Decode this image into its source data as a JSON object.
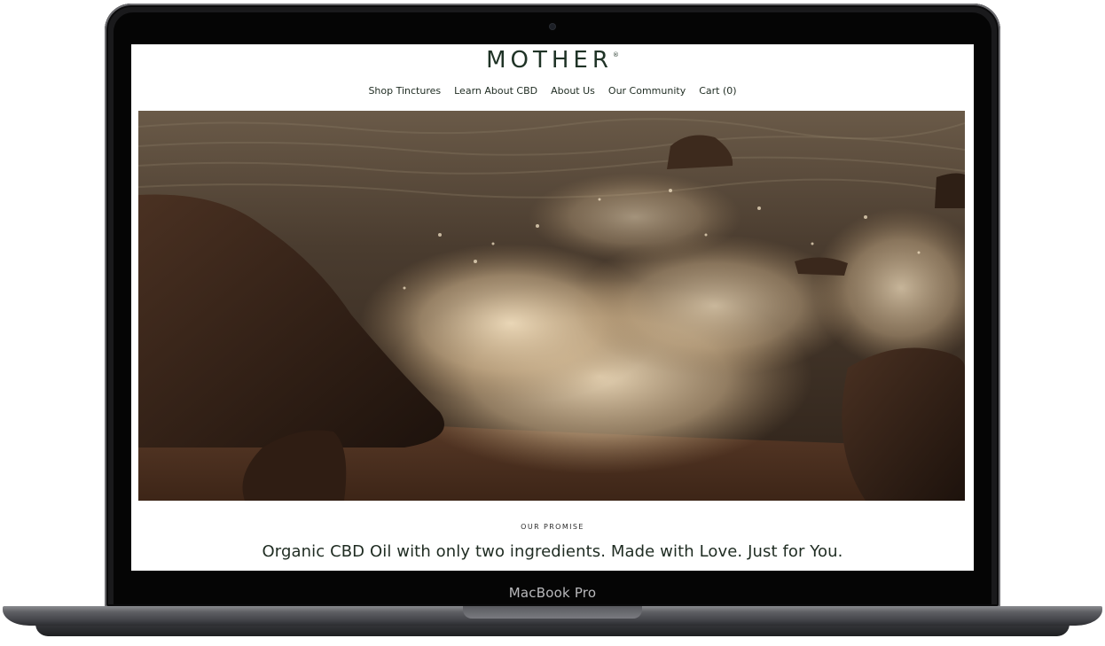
{
  "device": {
    "model_label": "MacBook Pro"
  },
  "site": {
    "logo_text": "MOTHER",
    "logo_mark": "®",
    "nav": [
      {
        "label": "Shop Tinctures"
      },
      {
        "label": "Learn About CBD"
      },
      {
        "label": "About Us"
      },
      {
        "label": "Our Community"
      },
      {
        "label": "Cart (0)"
      }
    ],
    "hero": {
      "image": "ocean-wave-crashing-on-rocks",
      "palette": {
        "sea": "#4a3a2c",
        "foam": "#d9c3a1",
        "rock": "#2a1a12",
        "sand": "#5a3b29"
      }
    },
    "promise": {
      "eyebrow": "OUR PROMISE",
      "headline": "Organic CBD Oil with only two ingredients. Made with Love. Just for You."
    },
    "colors": {
      "brand": "#1f3326",
      "text": "#1f2c22",
      "background": "#ffffff"
    }
  }
}
